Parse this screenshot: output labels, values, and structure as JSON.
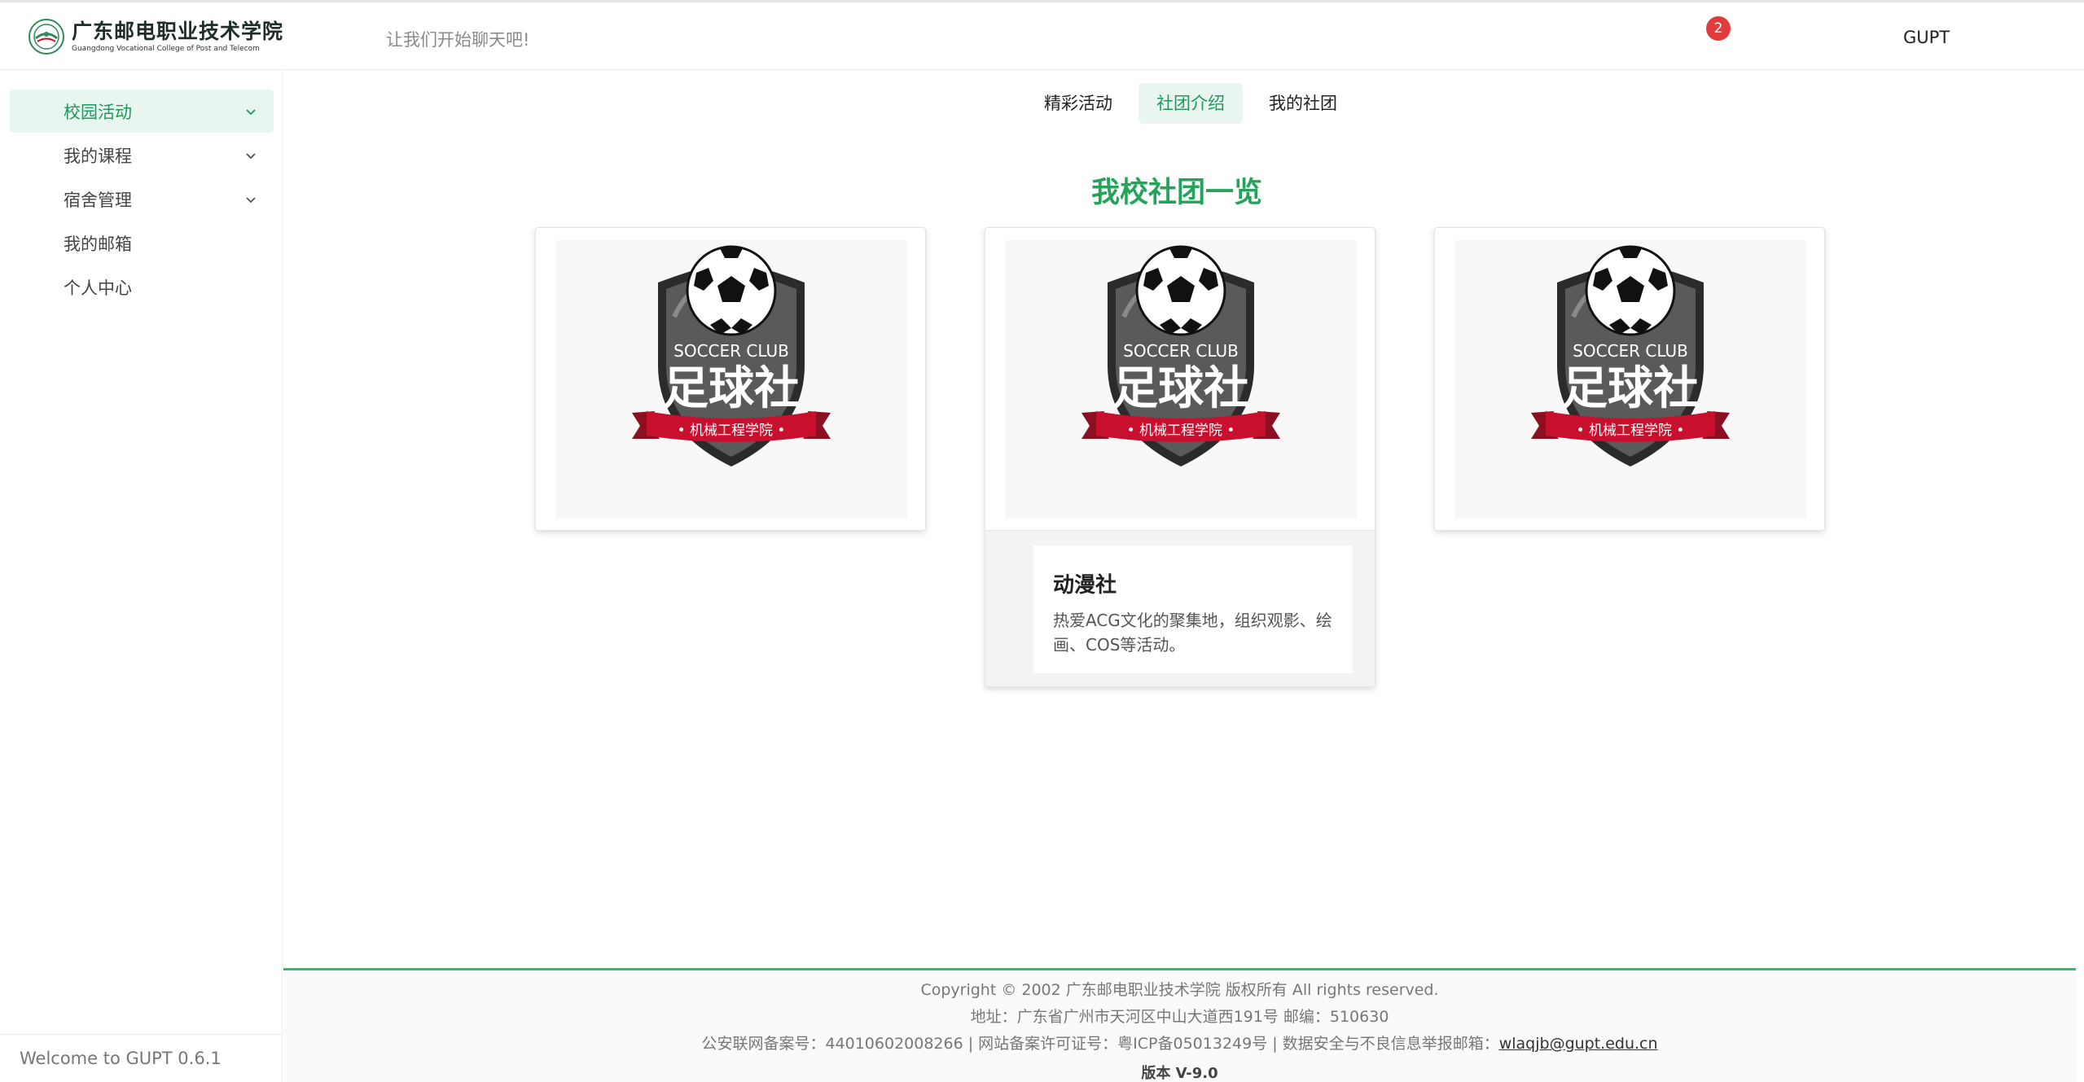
{
  "header": {
    "logo_cn": "广东邮电职业技术学院",
    "logo_en": "Guangdong Vocational College of Post and Telecom",
    "chat_hint": "让我们开始聊天吧!",
    "notification_count": "2",
    "username": "GUPT"
  },
  "sidebar": {
    "items": [
      {
        "label": "校园活动",
        "expandable": true,
        "active": true
      },
      {
        "label": "我的课程",
        "expandable": true,
        "active": false
      },
      {
        "label": "宿舍管理",
        "expandable": true,
        "active": false
      },
      {
        "label": "我的邮箱",
        "expandable": false,
        "active": false
      },
      {
        "label": "个人中心",
        "expandable": false,
        "active": false
      }
    ],
    "footer": "Welcome to GUPT 0.6.1"
  },
  "tabs": [
    {
      "label": "精彩活动",
      "active": false
    },
    {
      "label": "社团介绍",
      "active": true
    },
    {
      "label": "我的社团",
      "active": false
    }
  ],
  "main": {
    "title": "我校社团一览",
    "logo_text": {
      "club_en": "SOCCER CLUB",
      "club_cn": "足球社",
      "ribbon": "• 机械工程学院 •"
    },
    "cards": [
      {
        "name": "",
        "description": ""
      },
      {
        "name": "动漫社",
        "description": "热爱ACG文化的聚集地，组织观影、绘画、COS等活动。"
      },
      {
        "name": "",
        "description": ""
      }
    ]
  },
  "footer": {
    "copyright": "Copyright © 2002 广东邮电职业技术学院 版权所有 All rights reserved.",
    "address": "地址：广东省广州市天河区中山大道西191号  邮编：510630",
    "icp_prefix": "公安联网备案号：44010602008266 | 网站备案许可证号：粤ICP备05013249号 | 数据安全与不良信息举报邮箱：",
    "report_email": "wlaqjb@gupt.edu.cn",
    "version": "版本 V-9.0"
  },
  "colors": {
    "brand_green": "#26a35a",
    "active_bg": "#e9f6f0",
    "badge_red": "#e03c3c",
    "ribbon_red": "#c8102e"
  }
}
